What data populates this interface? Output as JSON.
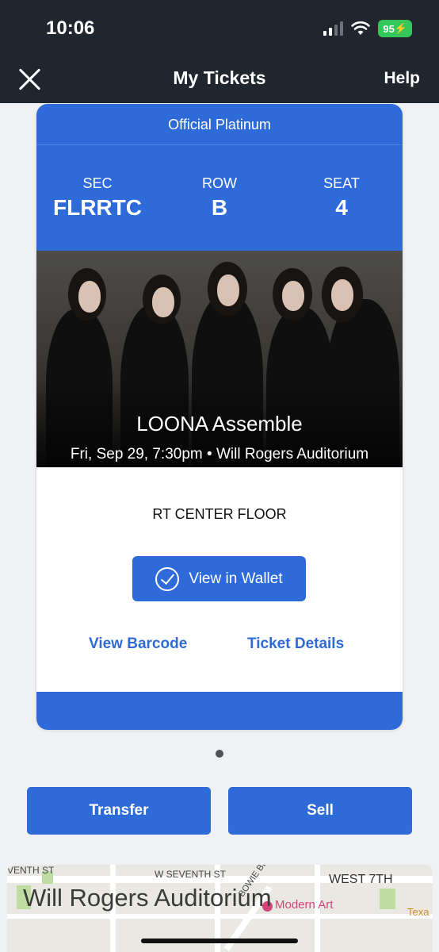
{
  "status_bar": {
    "time": "10:06",
    "battery": "95"
  },
  "nav": {
    "title": "My Tickets",
    "help": "Help"
  },
  "ticket": {
    "type": "Official Platinum",
    "sec_label": "SEC",
    "sec_value": "FLRRTC",
    "row_label": "ROW",
    "row_value": "B",
    "seat_label": "SEAT",
    "seat_value": "4",
    "event_name": "LOONA Assemble",
    "event_info": "Fri, Sep 29, 7:30pm • Will Rogers Auditorium",
    "section_name": "RT CENTER FLOOR",
    "wallet_label": "View in Wallet",
    "barcode_label": "View Barcode",
    "details_label": "Ticket Details"
  },
  "actions": {
    "transfer": "Transfer",
    "sell": "Sell"
  },
  "map": {
    "title": "Will Rogers Auditorium",
    "labels": [
      "VENTH ST",
      "W SEVENTH ST",
      "WEST 7TH",
      "BOWIE BLVD",
      "Modern Art",
      "Texa"
    ]
  },
  "colors": {
    "accent": "#2f6bd8",
    "nav_bg": "#1f262d",
    "battery": "#34c759"
  }
}
